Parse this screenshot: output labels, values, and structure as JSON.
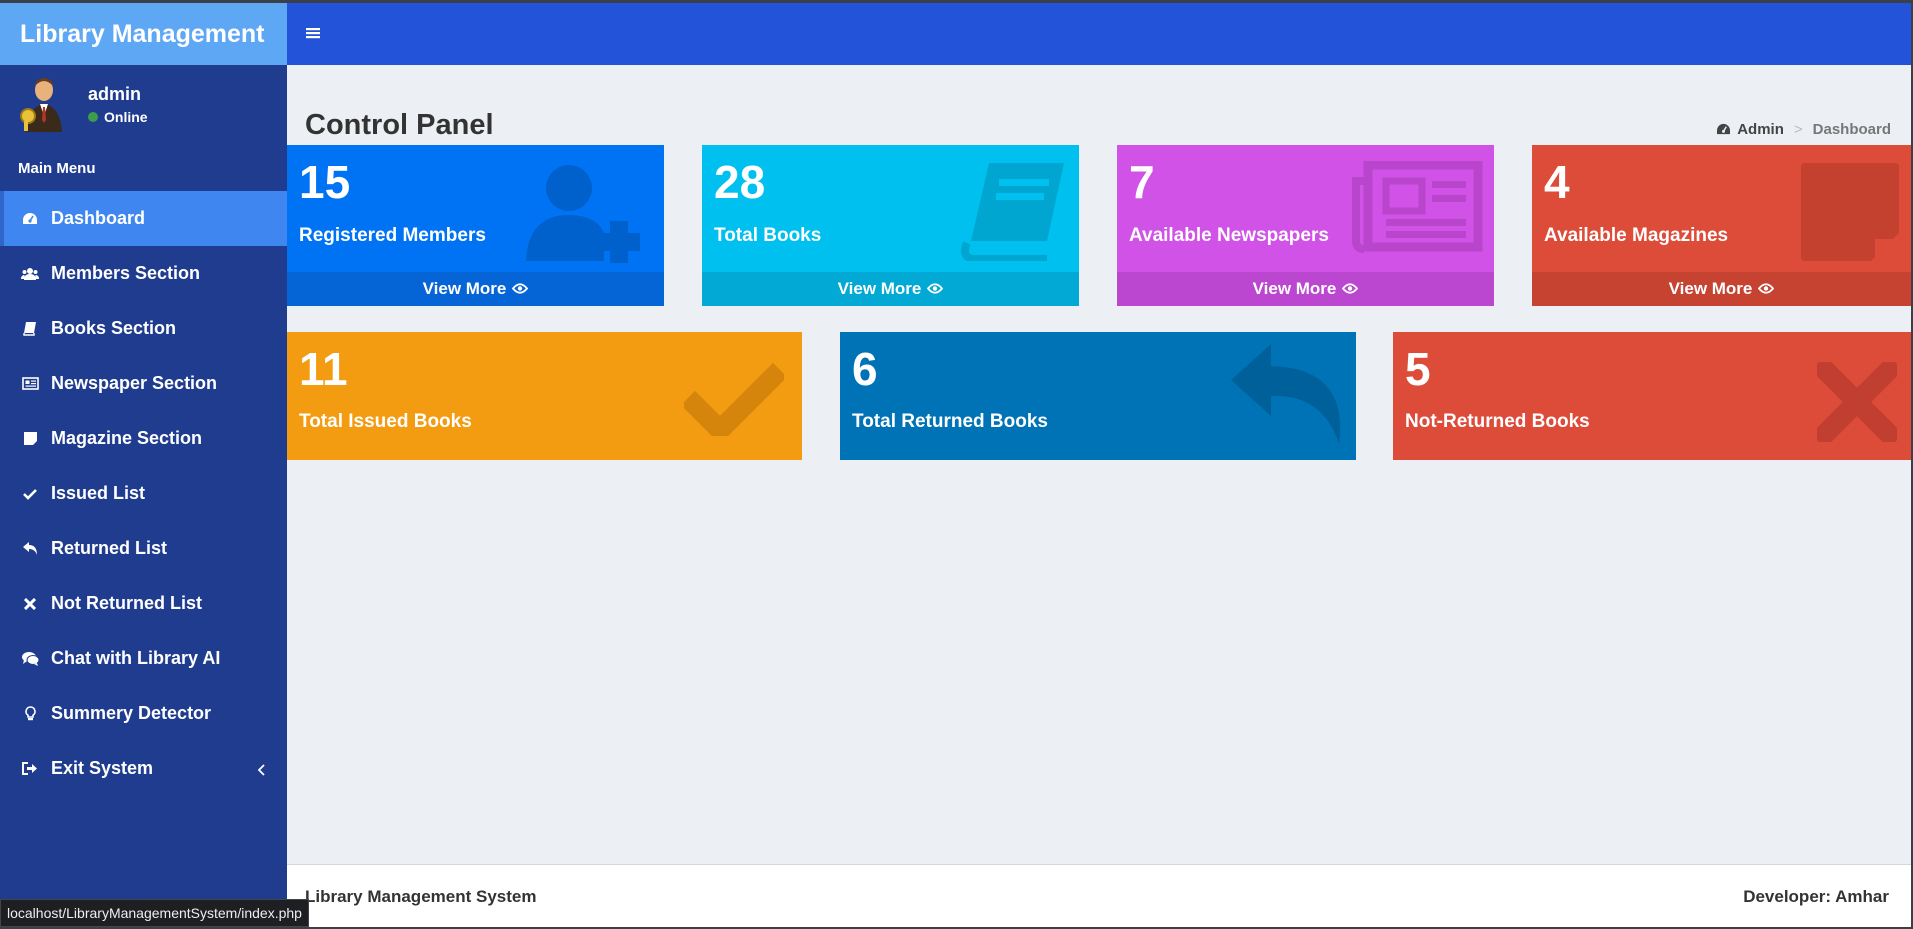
{
  "app": {
    "brand": "Library Management"
  },
  "user": {
    "name": "admin",
    "status": "Online"
  },
  "sidebar": {
    "section_label": "Main Menu",
    "items": [
      {
        "label": "Dashboard",
        "icon": "dashboard-icon",
        "active": true
      },
      {
        "label": "Members Section",
        "icon": "users-icon"
      },
      {
        "label": "Books Section",
        "icon": "book-icon"
      },
      {
        "label": "Newspaper Section",
        "icon": "newspaper-icon"
      },
      {
        "label": "Magazine Section",
        "icon": "sticky-note-icon"
      },
      {
        "label": "Issued List",
        "icon": "check-icon"
      },
      {
        "label": "Returned List",
        "icon": "reply-icon"
      },
      {
        "label": "Not Returned List",
        "icon": "times-icon"
      },
      {
        "label": "Chat with Library AI",
        "icon": "comments-icon"
      },
      {
        "label": "Summery Detector",
        "icon": "lightbulb-icon"
      },
      {
        "label": "Exit System",
        "icon": "sign-out-icon"
      }
    ]
  },
  "page": {
    "title": "Control Panel",
    "breadcrumb": [
      "Admin",
      ">",
      "Dashboard"
    ]
  },
  "stats_row1": [
    {
      "value": "15",
      "label": "Registered Members",
      "more": "View More",
      "color": "#0073f5",
      "footer_color": "#0565d6",
      "icon": "user-plus-icon"
    },
    {
      "value": "28",
      "label": "Total Books",
      "more": "View More",
      "color": "#00c0ef",
      "footer_color": "#01a9d4",
      "icon": "book-icon"
    },
    {
      "value": "7",
      "label": "Available Newspapers",
      "more": "View More",
      "color": "#d152e6",
      "footer_color": "#bb46cf",
      "icon": "newspaper-icon"
    },
    {
      "value": "4",
      "label": "Available Magazines",
      "more": "View More",
      "color": "#dd4b39",
      "footer_color": "#c64332",
      "icon": "sticky-note-icon"
    }
  ],
  "stats_row2": [
    {
      "value": "11",
      "label": "Total Issued Books",
      "color": "#f39c12",
      "icon": "check-icon"
    },
    {
      "value": "6",
      "label": "Total Returned Books",
      "color": "#0073b7",
      "icon": "reply-icon"
    },
    {
      "value": "5",
      "label": "Not-Returned Books",
      "color": "#dd4b39",
      "icon": "times-icon"
    }
  ],
  "footer": {
    "left": "Library Management System",
    "right": "Developer: Amhar"
  },
  "status_url": "localhost/LibraryManagementSystem/index.php"
}
